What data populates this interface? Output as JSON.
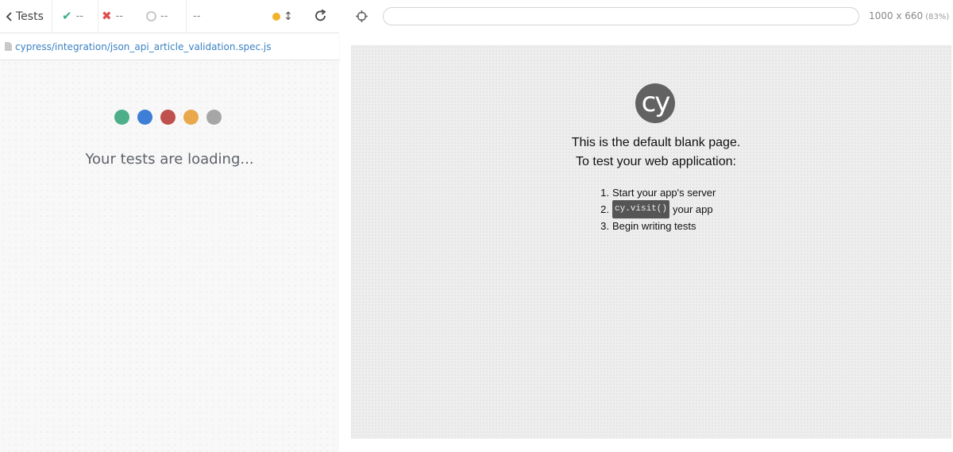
{
  "reporter": {
    "tests_label": "Tests",
    "stats": {
      "passed": "--",
      "failed": "--",
      "pending": "--",
      "duration": "--"
    },
    "spec_path": "cypress/integration/json_api_article_validation.spec.js",
    "loading_text": "Your tests are loading...",
    "loading_dot_colors": [
      "#4caf8a",
      "#3f7ed6",
      "#c0504d",
      "#e8a84b",
      "#a6a6a6"
    ]
  },
  "runner": {
    "url_value": "",
    "viewport_size": "1000 x 660",
    "viewport_scale": "(83%)",
    "logo_text": "cy",
    "blank_title_line1": "This is the default blank page.",
    "blank_title_line2": "To test your web application:",
    "steps": [
      {
        "num": "1.",
        "text": "Start your app's server"
      },
      {
        "num": "2.",
        "code": "cy.visit()",
        "text": "your app"
      },
      {
        "num": "3.",
        "text": "Begin writing tests"
      }
    ]
  }
}
